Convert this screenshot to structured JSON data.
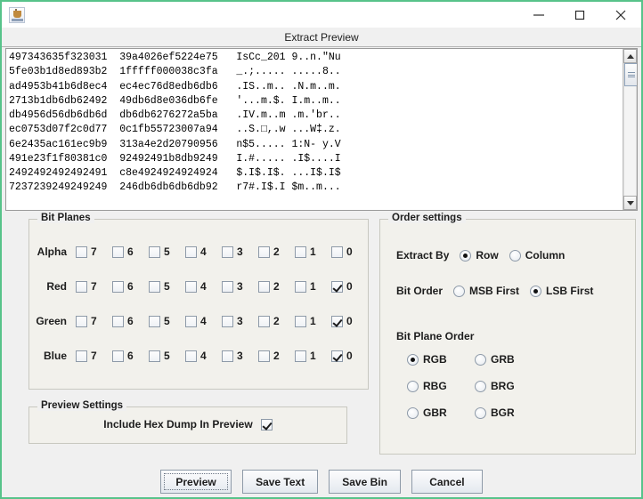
{
  "window": {
    "icon": "java-coffee-cup-icon",
    "header_title": "Extract Preview",
    "minimize_label": "–",
    "maximize_label": "☐",
    "close_label": "✕",
    "border_color": "#57c38a"
  },
  "preview": {
    "hexdump": "497343635f323031  39a4026ef5224e75   IsCc_201 9..n.\"Nu\n5fe03b1d8ed893b2  1fffff000038c3fa   _.;..... .....8..\nad4953b41b6d8ec4  ec4ec76d8edb6db6   .IS..m.. .N.m..m.\n2713b1db6db62492  49db6d8e036db6fe   '...m.$. I.m..m..\ndb4956d56db6db6d  db6db6276272a5ba   .IV.m..m .m.'br..\nec0753d07f2c0d77  0c1fb55723007a94   ..S.□,.w ...W‡.z.\n6e2435ac161ec9b9  313a4e2d20790956   n$5..... 1:N- y.V\n491e23f1f80381c0  92492491b8db9249   I.#..... .I$....I\n2492492492492491  c8e4924924924924   $.I$.I$. ...I$.I$\n7237239249249249  246db6db6db6db92   r7#.I$.I $m..m...\n"
  },
  "bit_planes": {
    "legend": "Bit Planes",
    "bits": [
      "7",
      "6",
      "5",
      "4",
      "3",
      "2",
      "1",
      "0"
    ],
    "channels": [
      {
        "label": "Alpha",
        "checked": [
          false,
          false,
          false,
          false,
          false,
          false,
          false,
          false
        ]
      },
      {
        "label": "Red",
        "checked": [
          false,
          false,
          false,
          false,
          false,
          false,
          false,
          true
        ]
      },
      {
        "label": "Green",
        "checked": [
          false,
          false,
          false,
          false,
          false,
          false,
          false,
          true
        ]
      },
      {
        "label": "Blue",
        "checked": [
          false,
          false,
          false,
          false,
          false,
          false,
          false,
          true
        ]
      }
    ]
  },
  "order_settings": {
    "legend": "Order settings",
    "extract_by": {
      "label": "Extract By",
      "options": [
        "Row",
        "Column"
      ],
      "selected": "Row"
    },
    "bit_order": {
      "label": "Bit Order",
      "options": [
        "MSB First",
        "LSB First"
      ],
      "selected": "LSB First"
    },
    "bit_plane_order": {
      "label": "Bit Plane Order",
      "options": [
        "RGB",
        "GRB",
        "RBG",
        "BRG",
        "GBR",
        "BGR"
      ],
      "selected": "RGB"
    }
  },
  "preview_settings": {
    "legend": "Preview Settings",
    "include_hex_dump_label": "Include Hex Dump In Preview",
    "include_hex_dump_checked": true
  },
  "buttons": {
    "preview": "Preview",
    "save_text": "Save Text",
    "save_bin": "Save Bin",
    "cancel": "Cancel",
    "focused": "Preview"
  }
}
